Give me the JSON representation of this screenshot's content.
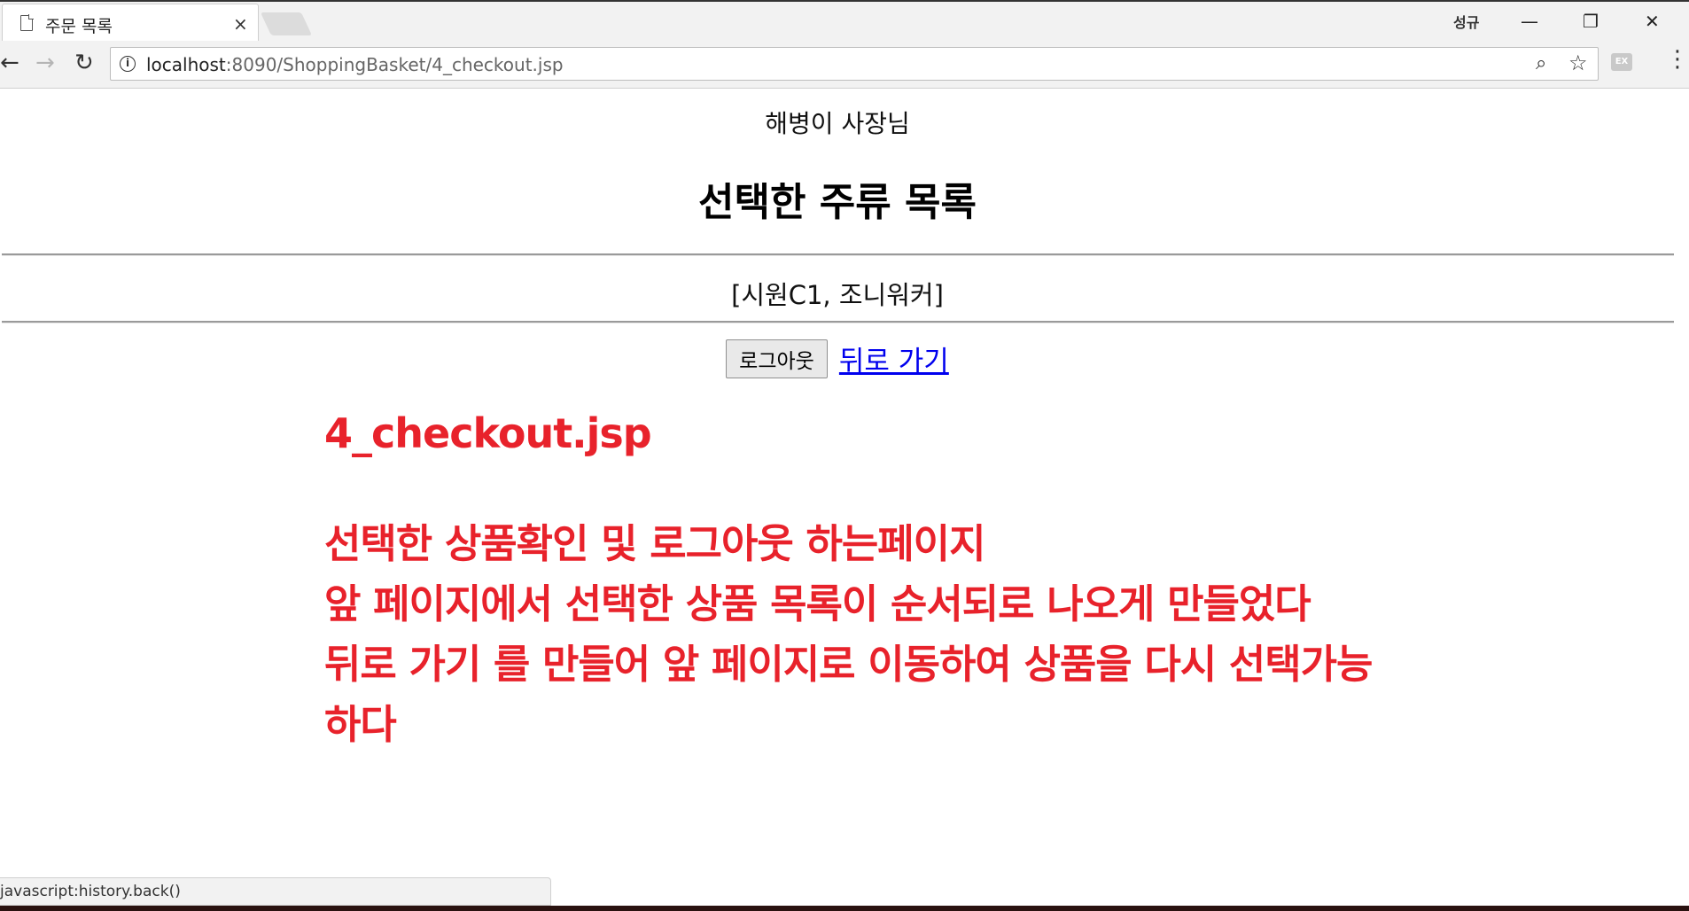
{
  "browser": {
    "tab_title": "주문 목록",
    "user": "성규",
    "url_host": "localhost",
    "url_rest": ":8090/ShoppingBasket/4_checkout.jsp",
    "status_text": "javascript:history.back()"
  },
  "page": {
    "greeting": "해병이 사장님",
    "heading": "선택한 주류 목록",
    "selected_items": "[시원C1, 조니워커]",
    "logout_label": "로그아웃",
    "back_label": "뒤로 가기"
  },
  "annotation": {
    "filename": "4_checkout.jsp",
    "lines": [
      "선택한 상품확인 및  로그아웃 하는페이지",
      "앞 페이지에서 선택한 상품 목록이 순서되로 나오게 만들었다",
      "뒤로 가기 를 만들어 앞 페이지로 이동하여 상품을 다시 선택가능",
      "하다"
    ],
    "color": "#e8222b"
  }
}
